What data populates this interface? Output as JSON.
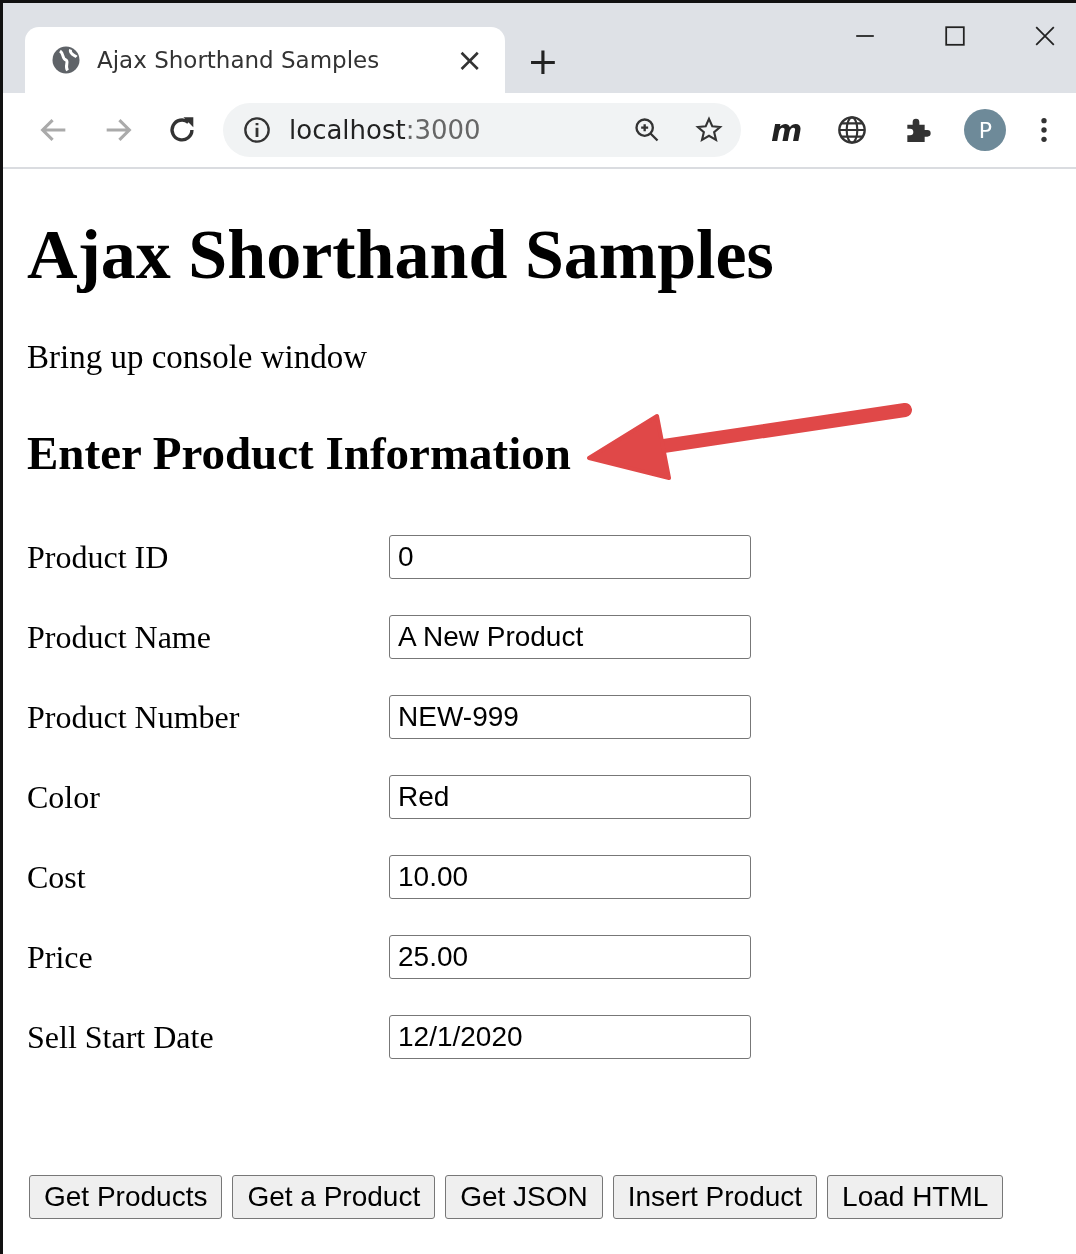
{
  "browser": {
    "tab_title": "Ajax Shorthand Samples",
    "tab_close": "×",
    "new_tab": "+",
    "address": {
      "host": "localhost",
      "port": ":3000"
    },
    "extension_label": "m",
    "profile_initial": "P"
  },
  "page": {
    "title": "Ajax Shorthand Samples",
    "intro": "Bring up console window",
    "section_heading": "Enter Product Information",
    "fields": [
      {
        "label": "Product ID",
        "value": "0"
      },
      {
        "label": "Product Name",
        "value": "A New Product"
      },
      {
        "label": "Product Number",
        "value": "NEW-999"
      },
      {
        "label": "Color",
        "value": "Red"
      },
      {
        "label": "Cost",
        "value": "10.00"
      },
      {
        "label": "Price",
        "value": "25.00"
      },
      {
        "label": "Sell Start Date",
        "value": "12/1/2020"
      }
    ],
    "buttons": [
      "Get Products",
      "Get a Product",
      "Get JSON",
      "Insert Product",
      "Load HTML"
    ]
  }
}
